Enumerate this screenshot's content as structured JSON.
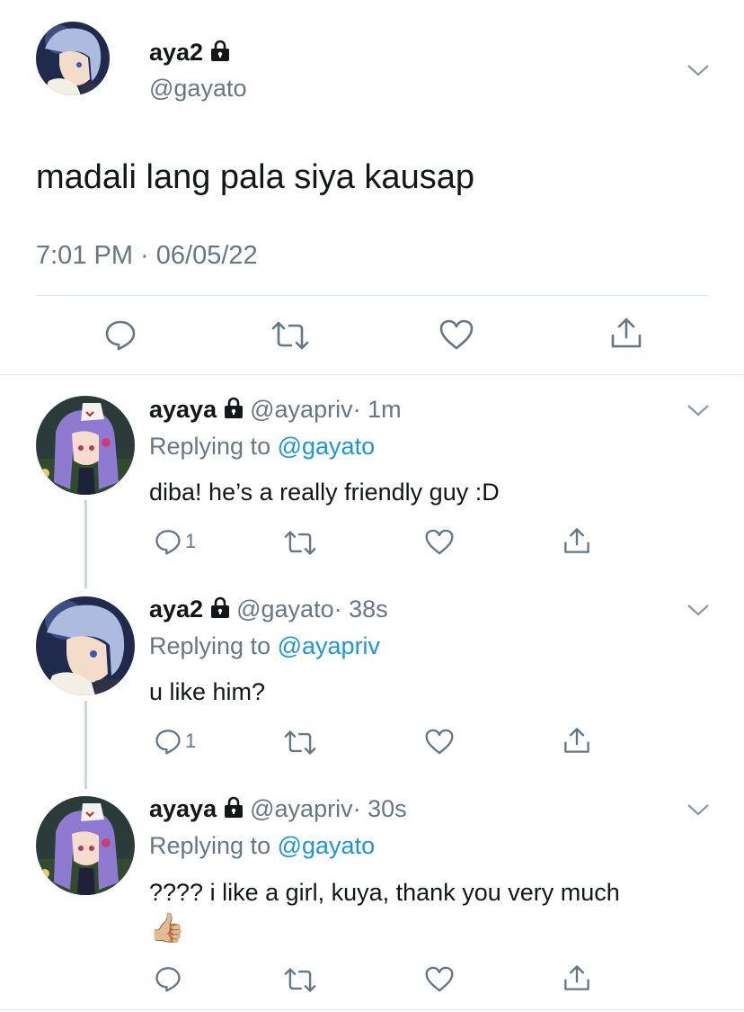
{
  "main_tweet": {
    "display_name": "aya2",
    "handle": "@gayato",
    "text": "madali lang pala siya kausap",
    "timestamp": "7:01 PM · 06/05/22"
  },
  "replies": [
    {
      "display_name": "ayaya",
      "handle": "@ayapriv",
      "time": "· 1m",
      "replying_prefix": "Replying to",
      "replying_to": "@gayato",
      "text": "diba! he’s a really friendly guy :D",
      "reply_count": "1"
    },
    {
      "display_name": "aya2",
      "handle": "@gayato",
      "time": "· 38s",
      "replying_prefix": "Replying to",
      "replying_to": "@ayapriv",
      "text": "u like him?",
      "reply_count": "1"
    },
    {
      "display_name": "ayaya",
      "handle": "@ayapriv",
      "time": "· 30s",
      "replying_prefix": "Replying to",
      "replying_to": "@gayato",
      "text": "???? i like a girl, kuya, thank you very much",
      "emoji": "👍🏼"
    }
  ],
  "colors": {
    "link": "#1b95e0",
    "secondary_text": "#657786",
    "divider": "#e1e8ed"
  },
  "icons": [
    "lock-icon",
    "chevron-down-icon",
    "reply-icon",
    "retweet-icon",
    "like-icon",
    "share-icon"
  ]
}
